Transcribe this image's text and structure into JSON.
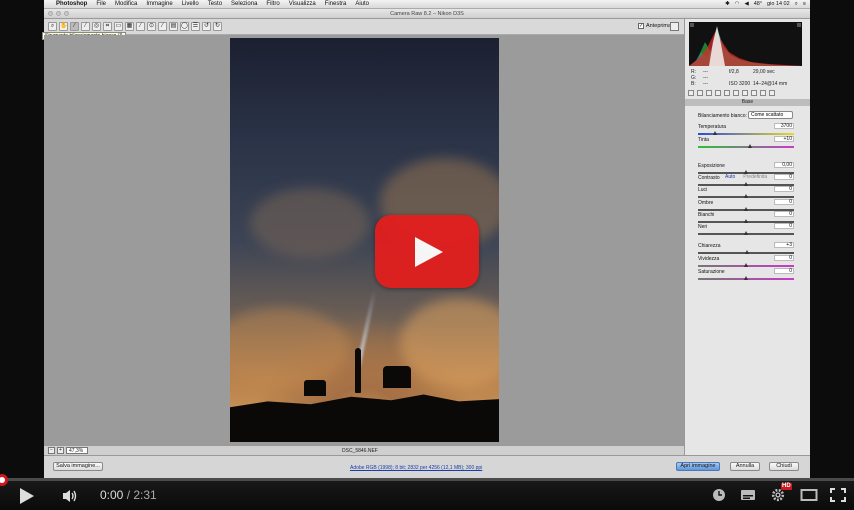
{
  "menubar": {
    "app": "Photoshop",
    "items": [
      "File",
      "Modifica",
      "Immagine",
      "Livello",
      "Testo",
      "Seleziona",
      "Filtro",
      "Visualizza",
      "Finestra",
      "Aiuto"
    ],
    "battery": "48°",
    "clock": "gio 14 02"
  },
  "window": {
    "title": "Camera Raw 8.2  –  Nikon D3S"
  },
  "toolbar": {
    "tooltip": "Strumento bilanciamento bianco (I)",
    "preview_label": "Anteprima",
    "preview_checked": "✓"
  },
  "statusbar": {
    "zoom": "47,3%",
    "filename": "DSC_5846.NEF"
  },
  "footer": {
    "save_label": "Salva immagine...",
    "workflow_link": "Adobe RGB (1998); 8 bit; 2832 per 4256 (12,1 MB); 300 ppi",
    "open_label": "Apri immagine",
    "cancel_label": "Annulla",
    "close_label": "Chiudi"
  },
  "panel": {
    "info": {
      "r": "R:",
      "g": "G:",
      "b": "B:",
      "dashes": "---",
      "aperture": "f/2,8",
      "shutter": "29,00 sec",
      "iso": "ISO 3200",
      "lens": "14–24@14 mm"
    },
    "section_title": "Base",
    "white_balance_label": "Bilanciamento bianco:",
    "white_balance_value": "Come scattato",
    "auto_label": "Auto",
    "default_label": "Predefinita",
    "controls": [
      {
        "label": "Temperatura",
        "value": "3700",
        "pos": 0.18
      },
      {
        "label": "Tinta",
        "value": "+10",
        "pos": 0.55
      },
      {
        "label": "Esposizione",
        "value": "0,00",
        "pos": 0.5
      },
      {
        "label": "Contrasto",
        "value": "0",
        "pos": 0.5
      },
      {
        "label": "Luci",
        "value": "0",
        "pos": 0.5
      },
      {
        "label": "Ombre",
        "value": "0",
        "pos": 0.5
      },
      {
        "label": "Bianchi",
        "value": "0",
        "pos": 0.5
      },
      {
        "label": "Neri",
        "value": "0",
        "pos": 0.5
      },
      {
        "label": "Chiarezza",
        "value": "+3",
        "pos": 0.52
      },
      {
        "label": "Vividezza",
        "value": "0",
        "pos": 0.5
      },
      {
        "label": "Saturazione",
        "value": "0",
        "pos": 0.5
      }
    ]
  },
  "player": {
    "current": "0:00",
    "separator": " / ",
    "duration": "2:31",
    "hd_badge": "HD",
    "progress": 0.0,
    "colors": {
      "accent": "#cc181e",
      "play_button": "#e31e1e"
    }
  }
}
